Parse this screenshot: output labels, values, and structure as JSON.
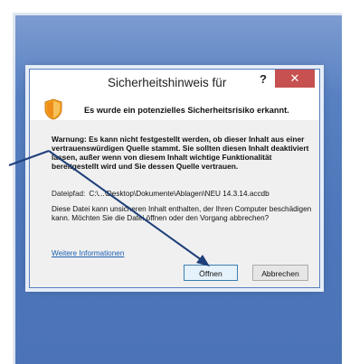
{
  "dialog": {
    "title": "Sicherheitshinweis für",
    "help_label": "?",
    "close_label": "✕",
    "heading": "Es wurde ein potenzielles Sicherheitsrisiko erkannt.",
    "warning": "Warnung: Es kann nicht festgestellt werden, ob dieser Inhalt aus einer vertrauenswürdigen Quelle stammt. Sie sollten diesen Inhalt deaktiviert lassen, außer wenn von diesem Inhalt wichtige Funktionalität bereitgestellt wird und Sie dessen Quelle vertrauen.",
    "file_path_label": "Dateipfad:",
    "file_path_value": "C:\\...\\Desktop\\Dokumente\\Ablagen\\NEU 14.3.14.accdb",
    "info": "Diese Datei kann unsicheren Inhalt enthalten, der Ihren Computer beschädigen kann. Möchten Sie die Datei öffnen oder den Vorgang abbrechen?",
    "more_info_link": "Weitere Informationen",
    "open_button": "Öffnen",
    "cancel_button": "Abbrechen"
  },
  "colors": {
    "accent_blue": "#4e78bb",
    "close_red": "#c75050",
    "link_blue": "#1a5fb4",
    "arrow": "#1f3f7a"
  },
  "icons": {
    "shield": "shield-warning-icon",
    "annotation": "annotation-arrow"
  }
}
